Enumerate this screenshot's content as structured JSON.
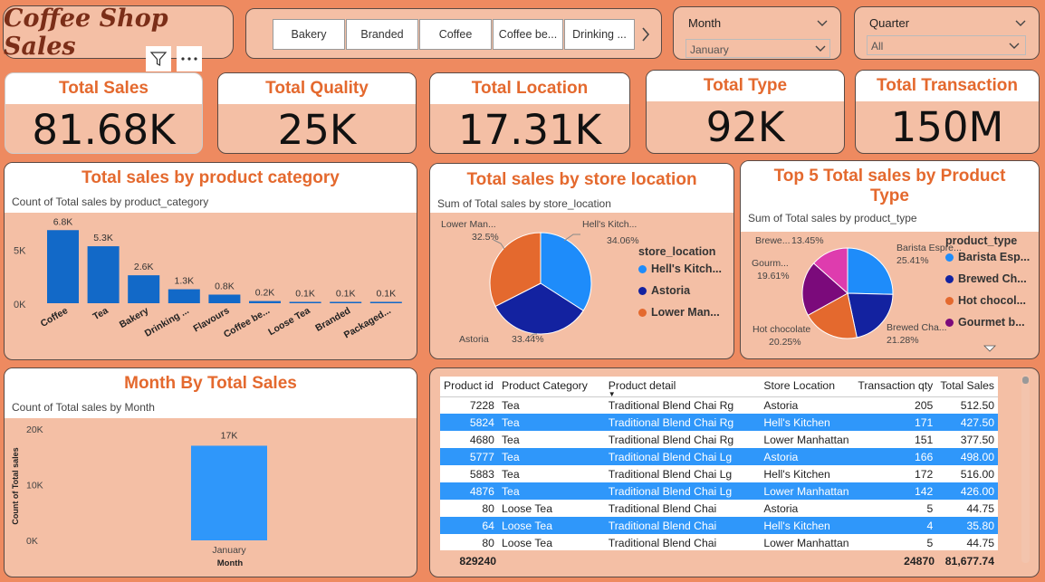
{
  "app": {
    "title": "Coffee Shop Sales"
  },
  "colors": {
    "background": "#EE8A60",
    "card": "#F4BFA5",
    "accent_title": "#E4692E",
    "bar": "#1269C8",
    "bar_light": "#2F97FA",
    "pie_blue": "#1E8CFA",
    "pie_navy": "#1322A0",
    "pie_orange": "#E4692E",
    "pie_purple": "#7B0A7B",
    "pie_pink": "#DE3CAE"
  },
  "slicer": {
    "buttons": [
      "Bakery",
      "Branded",
      "Coffee",
      "Coffee be...",
      "Drinking ..."
    ],
    "next_icon": "chevron-right-icon"
  },
  "month_filter": {
    "label": "Month",
    "value": "January"
  },
  "quarter_filter": {
    "label": "Quarter",
    "value": "All"
  },
  "visual_icons": {
    "filter": "filter-icon",
    "more": "more-options-icon"
  },
  "kpis": [
    {
      "label": "Total Sales",
      "value": "81.68K"
    },
    {
      "label": "Total Quality",
      "value": "25K"
    },
    {
      "label": "Total Location",
      "value": "17.31K"
    },
    {
      "label": "Total Type",
      "value": "92K"
    },
    {
      "label": "Total Transaction",
      "value": "150M"
    }
  ],
  "category_chart": {
    "title": "Total sales by product category",
    "subtitle": "Count of Total sales by product_category"
  },
  "location_chart": {
    "title": "Total sales by store location",
    "subtitle": "Sum of Total sales by store_location",
    "legend_title": "store_location"
  },
  "type_chart": {
    "title_line1": "Top 5 Total sales by Product",
    "title_line2": "Type",
    "subtitle": "Sum of Total sales by product_type",
    "legend_title": "product_type",
    "scroll_icon": "caret-down-icon"
  },
  "month_chart": {
    "title": "Month By Total Sales",
    "subtitle": "Count of Total sales by Month"
  },
  "table": {
    "headers": [
      "Product id",
      "Product Category",
      "Product detail",
      "Store Location",
      "Transaction qty",
      "Total Sales"
    ],
    "rows": [
      [
        "7228",
        "Tea",
        "Traditional Blend Chai Rg",
        "Astoria",
        "205",
        "512.50"
      ],
      [
        "5824",
        "Tea",
        "Traditional Blend Chai Rg",
        "Hell's Kitchen",
        "171",
        "427.50"
      ],
      [
        "4680",
        "Tea",
        "Traditional Blend Chai Rg",
        "Lower Manhattan",
        "151",
        "377.50"
      ],
      [
        "5777",
        "Tea",
        "Traditional Blend Chai Lg",
        "Astoria",
        "166",
        "498.00"
      ],
      [
        "5883",
        "Tea",
        "Traditional Blend Chai Lg",
        "Hell's Kitchen",
        "172",
        "516.00"
      ],
      [
        "4876",
        "Tea",
        "Traditional Blend Chai Lg",
        "Lower Manhattan",
        "142",
        "426.00"
      ],
      [
        "80",
        "Loose Tea",
        "Traditional Blend Chai",
        "Astoria",
        "5",
        "44.75"
      ],
      [
        "64",
        "Loose Tea",
        "Traditional Blend Chai",
        "Hell's Kitchen",
        "4",
        "35.80"
      ],
      [
        "80",
        "Loose Tea",
        "Traditional Blend Chai",
        "Lower Manhattan",
        "5",
        "44.75"
      ]
    ],
    "totals": {
      "product_id": "829240",
      "transaction_qty": "24870",
      "total_sales": "81,677.74"
    }
  },
  "chart_data": [
    {
      "type": "bar",
      "title": "Total sales by product category",
      "subtitle": "Count of Total sales by product_category",
      "categories": [
        "Coffee",
        "Tea",
        "Bakery",
        "Drinking ...",
        "Flavours",
        "Coffee be...",
        "Loose Tea",
        "Branded",
        "Packaged..."
      ],
      "values": [
        6800,
        5300,
        2600,
        1300,
        800,
        200,
        100,
        100,
        100
      ],
      "data_labels": [
        "6.8K",
        "5.3K",
        "2.6K",
        "1.3K",
        "0.8K",
        "0.2K",
        "0.1K",
        "0.1K",
        "0.1K"
      ],
      "y_ticks": [
        "0K",
        "5K"
      ],
      "ylim": [
        0,
        8000
      ]
    },
    {
      "type": "pie",
      "title": "Total sales by store location",
      "subtitle": "Sum of Total sales by store_location",
      "legend_title": "store_location",
      "labels": [
        "Hell's Kitch...",
        "Astoria",
        "Lower Man..."
      ],
      "legend_labels": [
        "Hell's Kitch...",
        "Astoria",
        "Lower Man..."
      ],
      "values": [
        34.06,
        33.44,
        32.5
      ],
      "value_labels": [
        "34.06%",
        "33.44%",
        "32.5%"
      ]
    },
    {
      "type": "pie",
      "title": "Top 5 Total sales by Product Type",
      "subtitle": "Sum of Total sales by product_type",
      "legend_title": "product_type",
      "labels": [
        "Barista Espre...",
        "Brewed Cha...",
        "Hot chocolate",
        "Gourm...",
        "Brewe..."
      ],
      "legend_labels": [
        "Barista Esp...",
        "Brewed Ch...",
        "Hot chocol...",
        "Gourmet b..."
      ],
      "values": [
        25.41,
        21.28,
        20.25,
        19.61,
        13.45
      ],
      "value_labels": [
        "25.41%",
        "21.28%",
        "20.25%",
        "19.61%",
        "13.45%"
      ]
    },
    {
      "type": "bar",
      "title": "Month By Total Sales",
      "subtitle": "Count of Total sales by Month",
      "categories": [
        "January"
      ],
      "values": [
        17000
      ],
      "data_labels": [
        "17K"
      ],
      "xlabel": "Month",
      "ylabel": "Count of Total sales",
      "y_ticks": [
        "0K",
        "10K",
        "20K"
      ],
      "ylim": [
        0,
        20000
      ]
    }
  ]
}
